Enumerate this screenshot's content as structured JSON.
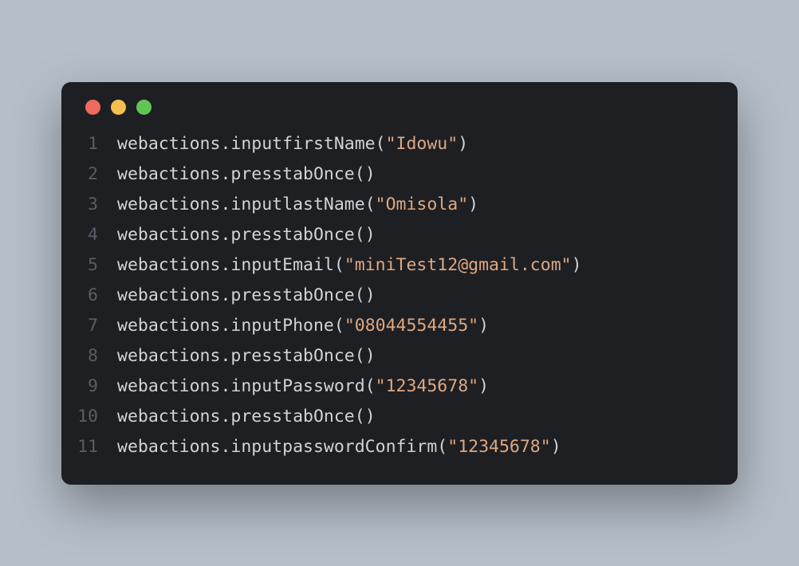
{
  "code": {
    "lines": [
      {
        "num": "1",
        "segments": [
          {
            "t": "object",
            "v": "webactions"
          },
          {
            "t": "punct",
            "v": "."
          },
          {
            "t": "method",
            "v": "inputfirstName"
          },
          {
            "t": "punct",
            "v": "("
          },
          {
            "t": "string",
            "v": "\"Idowu\""
          },
          {
            "t": "punct",
            "v": ")"
          }
        ]
      },
      {
        "num": "2",
        "segments": [
          {
            "t": "object",
            "v": "webactions"
          },
          {
            "t": "punct",
            "v": "."
          },
          {
            "t": "method",
            "v": "presstabOnce"
          },
          {
            "t": "punct",
            "v": "()"
          }
        ]
      },
      {
        "num": "3",
        "segments": [
          {
            "t": "object",
            "v": "webactions"
          },
          {
            "t": "punct",
            "v": "."
          },
          {
            "t": "method",
            "v": "inputlastName"
          },
          {
            "t": "punct",
            "v": "("
          },
          {
            "t": "string",
            "v": "\"Omisola\""
          },
          {
            "t": "punct",
            "v": ")"
          }
        ]
      },
      {
        "num": "4",
        "segments": [
          {
            "t": "object",
            "v": "webactions"
          },
          {
            "t": "punct",
            "v": "."
          },
          {
            "t": "method",
            "v": "presstabOnce"
          },
          {
            "t": "punct",
            "v": "()"
          }
        ]
      },
      {
        "num": "5",
        "segments": [
          {
            "t": "object",
            "v": "webactions"
          },
          {
            "t": "punct",
            "v": "."
          },
          {
            "t": "method",
            "v": "inputEmail"
          },
          {
            "t": "punct",
            "v": "("
          },
          {
            "t": "string",
            "v": "\"miniTest12@gmail.com\""
          },
          {
            "t": "punct",
            "v": ")"
          }
        ]
      },
      {
        "num": "6",
        "segments": [
          {
            "t": "object",
            "v": "webactions"
          },
          {
            "t": "punct",
            "v": "."
          },
          {
            "t": "method",
            "v": "presstabOnce"
          },
          {
            "t": "punct",
            "v": "()"
          }
        ]
      },
      {
        "num": "7",
        "segments": [
          {
            "t": "object",
            "v": "webactions"
          },
          {
            "t": "punct",
            "v": "."
          },
          {
            "t": "method",
            "v": "inputPhone"
          },
          {
            "t": "punct",
            "v": "("
          },
          {
            "t": "string",
            "v": "\"08044554455\""
          },
          {
            "t": "punct",
            "v": ")"
          }
        ]
      },
      {
        "num": "8",
        "segments": [
          {
            "t": "object",
            "v": "webactions"
          },
          {
            "t": "punct",
            "v": "."
          },
          {
            "t": "method",
            "v": "presstabOnce"
          },
          {
            "t": "punct",
            "v": "()"
          }
        ]
      },
      {
        "num": "9",
        "segments": [
          {
            "t": "object",
            "v": "webactions"
          },
          {
            "t": "punct",
            "v": "."
          },
          {
            "t": "method",
            "v": "inputPassword"
          },
          {
            "t": "punct",
            "v": "("
          },
          {
            "t": "string",
            "v": "\"12345678\""
          },
          {
            "t": "punct",
            "v": ")"
          }
        ]
      },
      {
        "num": "10",
        "segments": [
          {
            "t": "object",
            "v": "webactions"
          },
          {
            "t": "punct",
            "v": "."
          },
          {
            "t": "method",
            "v": "presstabOnce"
          },
          {
            "t": "punct",
            "v": "()"
          }
        ]
      },
      {
        "num": "11",
        "segments": [
          {
            "t": "object",
            "v": "webactions"
          },
          {
            "t": "punct",
            "v": "."
          },
          {
            "t": "method",
            "v": "inputpasswordConfirm"
          },
          {
            "t": "punct",
            "v": "("
          },
          {
            "t": "string",
            "v": "\"12345678\""
          },
          {
            "t": "punct",
            "v": ")"
          }
        ]
      }
    ]
  }
}
